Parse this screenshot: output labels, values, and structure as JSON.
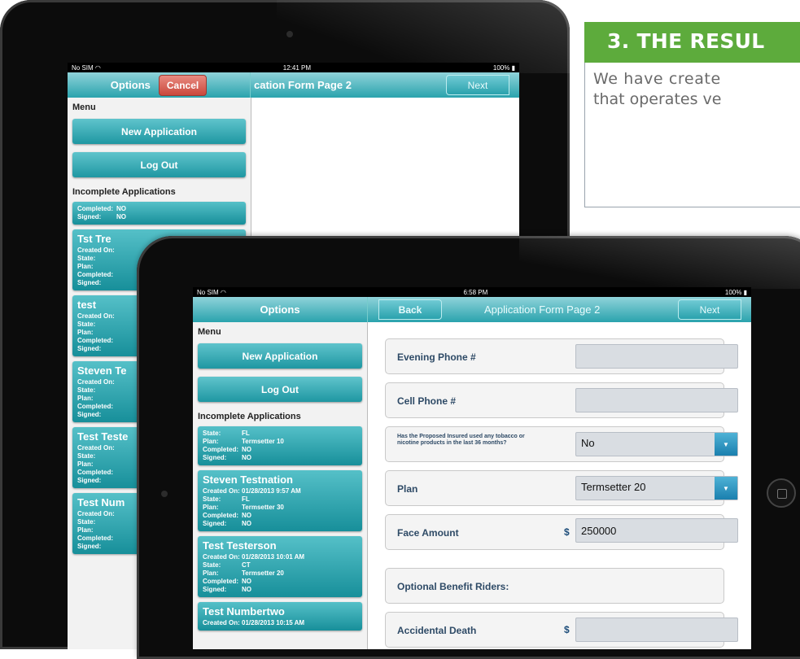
{
  "result": {
    "heading": "3. THE RESUL",
    "line1": "We have create",
    "line2": "that operates ve"
  },
  "back_ipad": {
    "status": {
      "carrier": "No SIM",
      "time": "12:41 PM",
      "battery": "100%"
    },
    "nav": {
      "options": "Options",
      "cancel": "Cancel",
      "title": "cation Form Page 2",
      "next": "Next"
    },
    "menu_label": "Menu",
    "new_application": "New Application",
    "log_out": "Log Out",
    "incomplete_label": "Incomplete Applications",
    "cards": [
      {
        "name": "",
        "rows": [
          {
            "k": "Completed:",
            "v": "NO"
          },
          {
            "k": "Signed:",
            "v": "NO"
          }
        ]
      },
      {
        "name": "Tst Tre",
        "rows": [
          {
            "k": "Created On:",
            "v": ""
          },
          {
            "k": "State:",
            "v": ""
          },
          {
            "k": "Plan:",
            "v": ""
          },
          {
            "k": "Completed:",
            "v": ""
          },
          {
            "k": "Signed:",
            "v": ""
          }
        ]
      },
      {
        "name": "test",
        "rows": [
          {
            "k": "Created On:",
            "v": ""
          },
          {
            "k": "State:",
            "v": ""
          },
          {
            "k": "Plan:",
            "v": ""
          },
          {
            "k": "Completed:",
            "v": ""
          },
          {
            "k": "Signed:",
            "v": ""
          }
        ]
      },
      {
        "name": "Steven Te",
        "rows": [
          {
            "k": "Created On:",
            "v": ""
          },
          {
            "k": "State:",
            "v": ""
          },
          {
            "k": "Plan:",
            "v": ""
          },
          {
            "k": "Completed:",
            "v": ""
          },
          {
            "k": "Signed:",
            "v": ""
          }
        ]
      },
      {
        "name": "Test Teste",
        "rows": [
          {
            "k": "Created On:",
            "v": ""
          },
          {
            "k": "State:",
            "v": ""
          },
          {
            "k": "Plan:",
            "v": ""
          },
          {
            "k": "Completed:",
            "v": ""
          },
          {
            "k": "Signed:",
            "v": ""
          }
        ]
      },
      {
        "name": "Test Num",
        "rows": [
          {
            "k": "Created On:",
            "v": ""
          },
          {
            "k": "State:",
            "v": ""
          },
          {
            "k": "Plan:",
            "v": ""
          },
          {
            "k": "Completed:",
            "v": ""
          },
          {
            "k": "Signed:",
            "v": ""
          }
        ]
      }
    ]
  },
  "front_ipad": {
    "status": {
      "carrier": "No SIM",
      "time": "6:58 PM",
      "battery": "100%"
    },
    "nav": {
      "options": "Options",
      "back": "Back",
      "title": "Application Form Page 2",
      "next": "Next"
    },
    "menu_label": "Menu",
    "new_application": "New Application",
    "log_out": "Log Out",
    "incomplete_label": "Incomplete Applications",
    "cards": [
      {
        "name": "",
        "rows": [
          {
            "k": "State:",
            "v": "FL"
          },
          {
            "k": "Plan:",
            "v": "Termsetter 10"
          },
          {
            "k": "Completed:",
            "v": "NO"
          },
          {
            "k": "Signed:",
            "v": "NO"
          }
        ]
      },
      {
        "name": "Steven Testnation",
        "rows": [
          {
            "k": "Created On:",
            "v": "01/28/2013 9:57 AM"
          },
          {
            "k": "State:",
            "v": "FL"
          },
          {
            "k": "Plan:",
            "v": "Termsetter 30"
          },
          {
            "k": "Completed:",
            "v": "NO"
          },
          {
            "k": "Signed:",
            "v": "NO"
          }
        ]
      },
      {
        "name": "Test Testerson",
        "rows": [
          {
            "k": "Created On:",
            "v": "01/28/2013 10:01 AM"
          },
          {
            "k": "State:",
            "v": "CT"
          },
          {
            "k": "Plan:",
            "v": "Termsetter 20"
          },
          {
            "k": "Completed:",
            "v": "NO"
          },
          {
            "k": "Signed:",
            "v": "NO"
          }
        ]
      },
      {
        "name": "Test Numbertwo",
        "rows": [
          {
            "k": "Created On:",
            "v": "01/28/2013 10:15 AM"
          }
        ]
      }
    ],
    "form": {
      "evening_phone_label": "Evening Phone #",
      "evening_phone_value": "",
      "cell_phone_label": "Cell Phone #",
      "cell_phone_value": "",
      "tobacco_label": "Has the Proposed Insured used any tobacco or nicotine products in the last 36 months?",
      "tobacco_value": "No",
      "plan_label": "Plan",
      "plan_value": "Termsetter 20",
      "face_amount_label": "Face Amount",
      "currency_symbol": "$",
      "face_amount_value": "250000",
      "optional_riders_label": "Optional Benefit Riders:",
      "accidental_death_label": "Accidental Death",
      "accidental_death_value": ""
    }
  }
}
